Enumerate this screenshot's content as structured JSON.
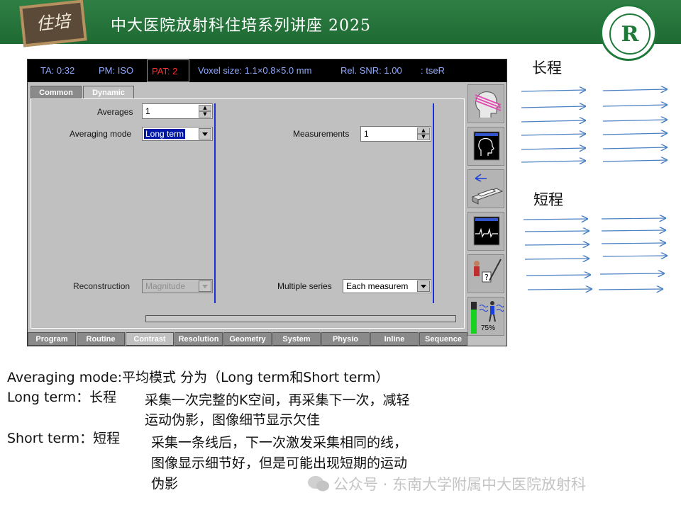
{
  "slide": {
    "title": "中大医院放射科住培系列讲座 2025",
    "board_text": "住培"
  },
  "status": {
    "ta": "TA: 0:32",
    "pm": "PM: ISO",
    "pat": "PAT: 2",
    "voxel": "Voxel size: 1.1×0.8×5.0 mm",
    "snr": "Rel. SNR: 1.00",
    "seq": ": tseR"
  },
  "top_tabs": [
    "Common",
    "Dynamic"
  ],
  "fields": {
    "averages_label": "Averages",
    "averages_value": "1",
    "averaging_mode_label": "Averaging mode",
    "averaging_mode_value": "Long term",
    "measurements_label": "Measurements",
    "measurements_value": "1",
    "reconstruction_label": "Reconstruction",
    "reconstruction_value": "Magnitude",
    "multiple_series_label": "Multiple series",
    "multiple_series_value": "Each measurem"
  },
  "sidebar": {
    "percent": "75%",
    "level": 0.75
  },
  "bottom_tabs": [
    "Program",
    "Routine",
    "Contrast",
    "Resolution",
    "Geometry",
    "System",
    "Physio",
    "Inline",
    "Sequence"
  ],
  "diagram": {
    "long_label": "长程",
    "short_label": "短程"
  },
  "notes": {
    "line1": "Averaging mode:平均模式 分为（Long term和Short term）",
    "long_term_term": "Long term：长程",
    "long_term_desc1": "采集一次完整的K空间，再采集下一次，减轻",
    "long_term_desc2": "运动伪影，图像细节显示欠佳",
    "short_term_term": "Short term：短程",
    "short_term_desc1": "采集一条线后，下一次激发采集相同的线，",
    "short_term_desc2": "图像显示细节好，但是可能出现短期的运动",
    "short_term_desc3": "伪影"
  },
  "footer": {
    "text": "公众号 · 东南大学附属中大医院放射科"
  },
  "colors": {
    "header_green": "#1e6a33",
    "arrow_blue": "#4a7fc1",
    "selection_blue": "#0018a8",
    "divider_blue": "#1c2fd6",
    "pat_red": "#ff3030"
  }
}
